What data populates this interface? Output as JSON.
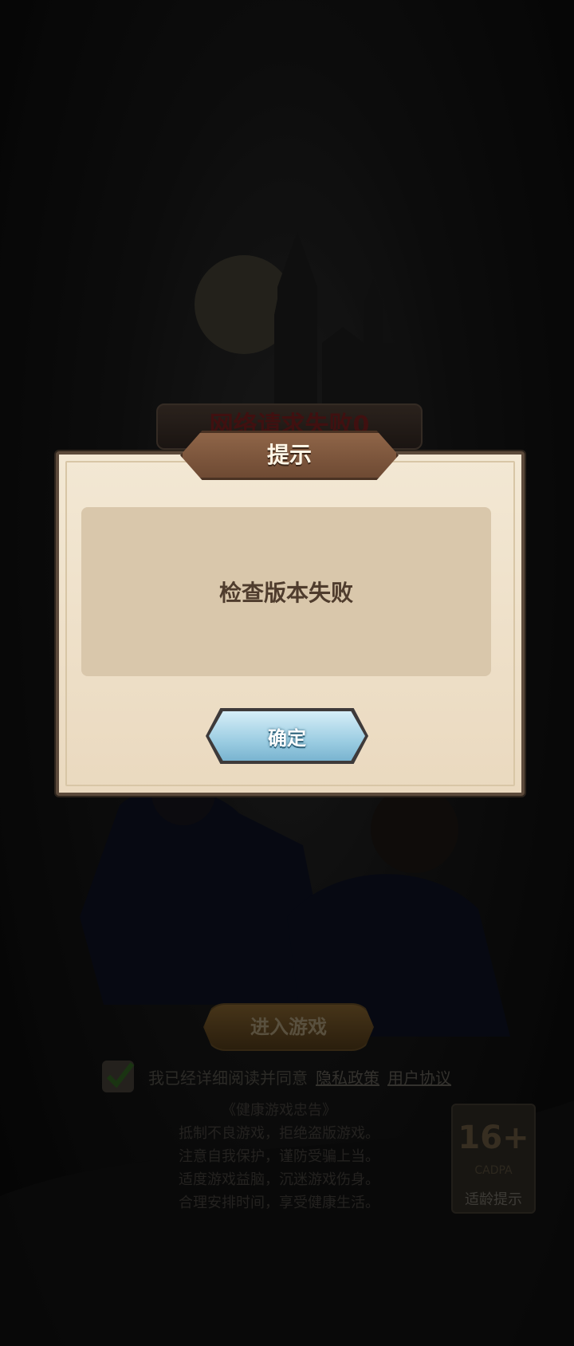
{
  "background": {
    "network_error": "网络请求失败0",
    "enter_button": "进入游戏",
    "agree_text": "我已经详细阅读并同意",
    "privacy_link": "隐私政策",
    "user_agreement_link": "用户协议",
    "health_title": "《健康游戏忠告》",
    "health_lines": [
      "抵制不良游戏，拒绝盗版游戏。",
      "注意自我保护，谨防受骗上当。",
      "适度游戏益脑，沉迷游戏伤身。",
      "合理安排时间，享受健康生活。"
    ],
    "age_rating": "16+",
    "age_org": "CADPA",
    "age_tip": "适龄提示"
  },
  "dialog": {
    "title": "提示",
    "message": "检查版本失败",
    "confirm_label": "确定"
  },
  "colors": {
    "dialog_paper": "#f0e3cc",
    "title_banner": "#7d563d",
    "confirm_button": "#9ccde2"
  }
}
